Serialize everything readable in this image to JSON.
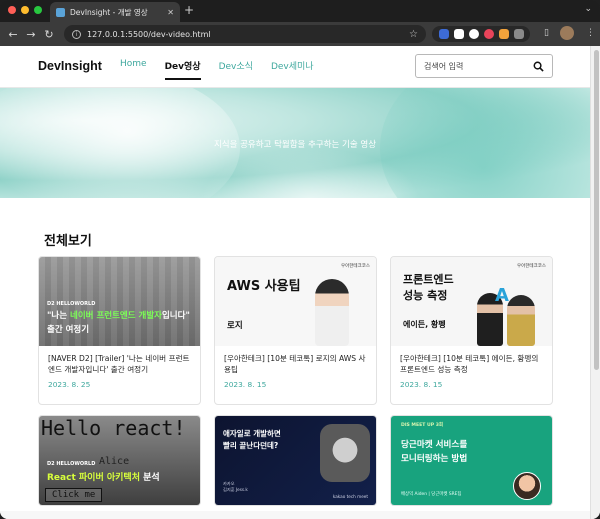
{
  "browser": {
    "tab_title": "DevInsight - 개발 영상",
    "new_tab_label": "+",
    "url": "127.0.0.1:5500/dev-video.html"
  },
  "icons": {
    "back": "back-arrow-icon",
    "forward": "forward-arrow-icon",
    "reload": "reload-icon",
    "star": "star-icon",
    "search": "search-icon",
    "sidebar": "sidebar-icon",
    "menu": "kebab-menu-icon"
  },
  "site": {
    "logo": "DevInsight",
    "nav": [
      {
        "label": "Home",
        "active": false
      },
      {
        "label": "Dev영상",
        "active": true
      },
      {
        "label": "Dev소식",
        "active": false
      },
      {
        "label": "Dev세미나",
        "active": false
      }
    ],
    "search_placeholder": "검색어 입력",
    "accent_color": "#3fa89e"
  },
  "hero": {
    "text": "지식을 공유하고 탁월함을 추구하는 기술 영상"
  },
  "section_title": "전체보기",
  "cards": [
    {
      "title": "[NAVER D2] [Trailer] '나는 네이버 프런트엔드 개발자입니다' 출간 여정기",
      "date": "2023. 8. 25",
      "thumb": {
        "tag": "D2 HELLOWORLD",
        "line1_pre": "\"나는 ",
        "line1_hl": "네이버 프런트엔드 개발자",
        "line1_post": "입니다\"",
        "line2": "출간 여정기"
      }
    },
    {
      "title": "[우아한테크] [10분 테코톡] 로지의 AWS 사용팁",
      "date": "2023. 8. 15",
      "thumb": {
        "corner": "우아한테크코스",
        "big": "AWS 사용팁",
        "small": "로지"
      }
    },
    {
      "title": "[우아한테크] [10분 테코톡] 에이든, 황펭의 프론트엔드 성능 측정",
      "date": "2023. 8. 15",
      "thumb": {
        "corner": "우아한테크코스",
        "big1": "프론트엔드",
        "big2": "성능 측정",
        "small": "에이든, 황펭",
        "letter": "A"
      }
    },
    {
      "thumb": {
        "hello": "Hello react!",
        "tag": "D2 HELLOWORLD",
        "name": "Alice",
        "title_hl": "React 파이버 아키텍처",
        "title_post": " 분석",
        "button": "Click me"
      }
    },
    {
      "thumb": {
        "q1": "애자일로 개발하면",
        "q2": "빨리 끝난다던데?",
        "speaker": "카카오\n김지훈 Jess.k",
        "brand": "kakao tech meet"
      }
    },
    {
      "thumb": {
        "tag": "DIS MEET UP 3회",
        "t1": "당근마켓 서비스를",
        "t2": "모니터링하는 방법",
        "speaker": "배상익 Aiden | 당근마켓 SRE팀"
      }
    }
  ]
}
